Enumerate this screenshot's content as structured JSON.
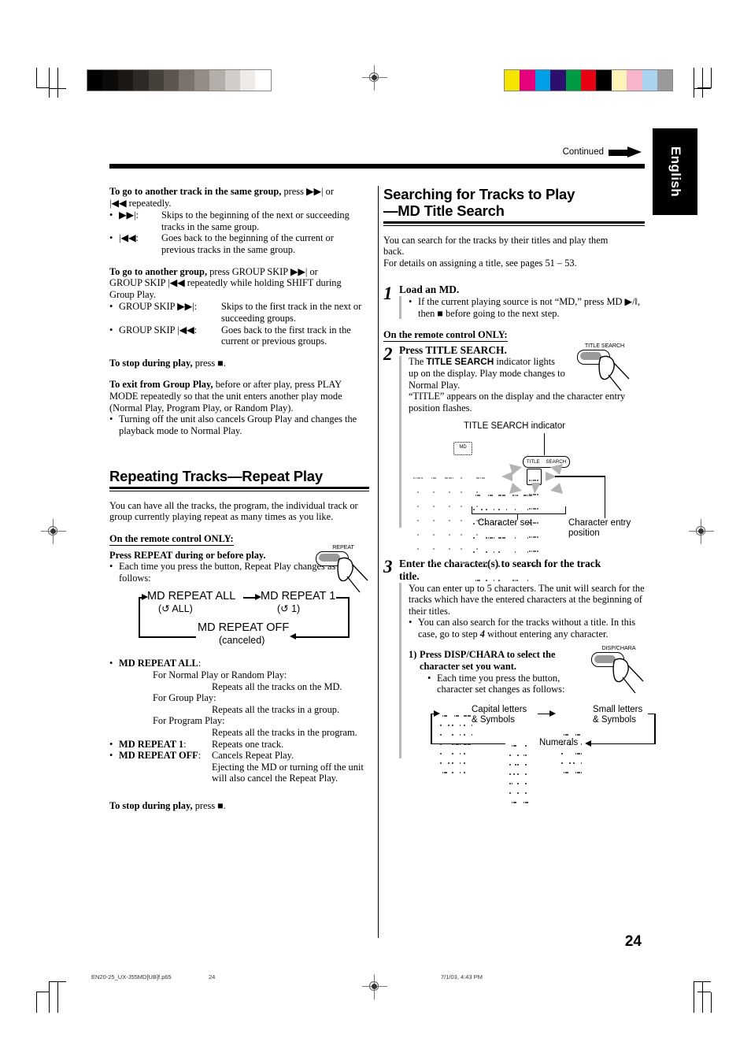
{
  "page": {
    "number": "24",
    "language_tab": "English",
    "continued_label": "Continued"
  },
  "footer": {
    "filename": "EN20-25_UX-J55MD[UB]f.p65",
    "page": "24",
    "timestamp": "7/1/03, 4:43 PM"
  },
  "left_column": {
    "block1": {
      "lead_bold": "To go to another track in the same group,",
      "lead_rest": " press ▶▶| or",
      "lead_line2": "|◀◀ repeatedly.",
      "items": [
        {
          "label": "▶▶|:",
          "text": "Skips to the beginning of the next or succeeding tracks in the same group."
        },
        {
          "label": "|◀◀:",
          "text": "Goes back to the beginning of the current or previous tracks in the same group."
        }
      ]
    },
    "block2": {
      "lead_bold": "To go to another group,",
      "lead_rest": " press GROUP SKIP ▶▶| or",
      "lead_line2": "GROUP SKIP |◀◀ repeatedly while holding SHIFT during",
      "lead_line3": "Group Play.",
      "items": [
        {
          "label": "GROUP SKIP ▶▶|:",
          "text": "Skips to the first track in the next or succeeding groups."
        },
        {
          "label": "GROUP SKIP |◀◀:",
          "text": "Goes back to the first track in the current or previous groups."
        }
      ]
    },
    "stop_line": {
      "bold": "To stop during play,",
      "rest": " press ■."
    },
    "block3": {
      "lead_bold": "To exit from Group Play,",
      "lead_rest": " before or after play, press PLAY MODE repeatedly so that the unit enters another play mode (Normal Play, Program Play, or Random Play).",
      "bullet": "Turning off the unit also cancels Group Play and changes the playback mode to Normal Play."
    },
    "heading": "Repeating Tracks—Repeat Play",
    "intro": "You can have all the tracks, the program, the individual track or group currently playing repeat as many times as you like.",
    "remote_only": "On the remote control ONLY:",
    "press_repeat": "Press REPEAT during or before play.",
    "press_repeat_bullet": "Each time you press the button, Repeat Play changes as follows:",
    "repeat_button_label": "REPEAT",
    "flow": {
      "item1": "MD REPEAT ALL",
      "item1_sub": "(↺ ALL)",
      "item2": "MD REPEAT 1",
      "item2_sub": "(↺ 1)",
      "item3": "MD REPEAT OFF",
      "item3_sub": "(canceled)"
    },
    "modes": [
      {
        "name": "MD REPEAT ALL",
        "colon": ":",
        "sub": [
          {
            "cond": "For Normal Play or Random Play:",
            "res": "Repeats all the tracks on the MD."
          },
          {
            "cond": "For Group Play:",
            "res": "Repeats all the tracks in a group."
          },
          {
            "cond": "For Program Play:",
            "res": "Repeats all the tracks in the program."
          }
        ]
      },
      {
        "name": "MD REPEAT 1",
        "colon": ":",
        "inline": "Repeats one track."
      },
      {
        "name": "MD REPEAT OFF",
        "colon": ":",
        "inline": "Cancels Repeat Play.",
        "extra": "Ejecting the MD or turning off the unit will also cancel the Repeat Play."
      }
    ],
    "stop_line2": {
      "bold": "To stop during play,",
      "rest": " press ■."
    }
  },
  "right_column": {
    "heading_line1": "Searching for Tracks to Play",
    "heading_line2": "—MD Title Search",
    "intro_line1": "You can search for the tracks by their titles and play them",
    "intro_line2": "back.",
    "intro_line3": "For details on assigning a title, see pages 51 – 53.",
    "step1": {
      "num": "1",
      "title": "Load an MD.",
      "bullet": "If the current playing source is not “MD,” press MD ▶/‖, then ■ before going to the next step."
    },
    "remote_only": "On the remote control ONLY:",
    "step2": {
      "num": "2",
      "title": "Press TITLE SEARCH.",
      "body_a": "The ",
      "body_bold": "TITLE SEARCH",
      "body_b": " indicator lights up on the display. Play mode changes to Normal Play.",
      "body_c": "“TITLE” appears on the display and the character entry position flashes.",
      "button_label": "TITLE SEARCH"
    },
    "display_figure": {
      "indicator_label": "TITLE SEARCH indicator",
      "badge_md": "MD",
      "badge_title": "TITLE",
      "badge_search": "SEARCH",
      "screen_line1": "TITLE",
      "screen_line2": "CAPIT",
      "label_charset": "Character set",
      "label_entry_line1": "Character entry",
      "label_entry_line2": "position"
    },
    "step3": {
      "num": "3",
      "title_line1": "Enter the character(s) to search for the track",
      "title_line2": "title.",
      "body": "You can enter up to 5 characters. The unit will search for the tracks which have the entered characters at the beginning of their titles.",
      "bullet_a": "You can also search for the tracks without a title. In this case, go to step ",
      "bullet_num": "4",
      "bullet_b": " without entering any character.",
      "sub1_label": "1)",
      "sub1_title_line1": "Press DISP/CHARA to select the",
      "sub1_title_line2": "character set you want.",
      "sub1_bullet_line1": "Each time you press the button,",
      "sub1_bullet_line2": "character set changes as follows:",
      "button_label": "DISP/CHARA",
      "charset_flow": {
        "item1_glyph": "CAP",
        "item1_line1": "Capital letters",
        "item1_line2": "& Symbols",
        "item2_glyph": "ca",
        "item2_line1": "Small letters",
        "item2_line2": "& Symbols",
        "item3_glyph": "01",
        "item3_label": "Numerals"
      }
    }
  },
  "calibration": {
    "gray_bars": [
      "#000000",
      "#0d0b0a",
      "#1b1715",
      "#2f2a26",
      "#46403b",
      "#5d5650",
      "#7a736c",
      "#948d86",
      "#b4aea8",
      "#d2cdc8",
      "#eeebe8",
      "#ffffff"
    ],
    "color_bars": [
      "#f5e400",
      "#e6007e",
      "#00a0e9",
      "#2d0f6e",
      "#009944",
      "#e60012",
      "#000000",
      "#fdf3b8",
      "#f7b5cb",
      "#a8d4f0",
      "#9a9a9a"
    ]
  }
}
